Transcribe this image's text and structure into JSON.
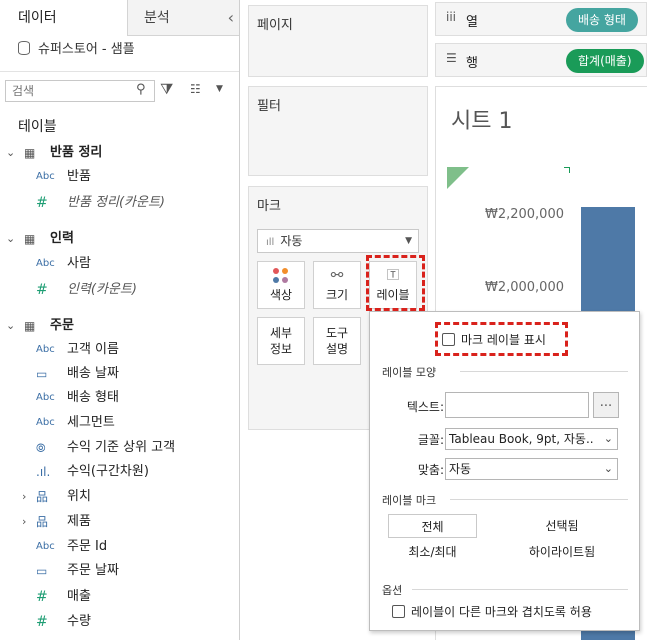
{
  "left_pane": {
    "tab_data": "데이터",
    "tab_analysis": "분석",
    "collapse": "‹",
    "datasource": "슈퍼스토어 - 샘플",
    "search_placeholder": "검색",
    "tables_heading": "테이블",
    "groups": [
      {
        "name": "반품 정리",
        "fields": [
          {
            "type": "Abc",
            "name": "반품",
            "italic": false
          },
          {
            "type": "#",
            "name": "반품 정리(카운트)",
            "italic": true
          }
        ]
      },
      {
        "name": "인력",
        "fields": [
          {
            "type": "Abc",
            "name": "사람",
            "italic": false
          },
          {
            "type": "#",
            "name": "인력(카운트)",
            "italic": true
          }
        ]
      },
      {
        "name": "주문",
        "fields": [
          {
            "type": "Abc",
            "name": "고객 이름"
          },
          {
            "type": "date",
            "name": "배송 날짜"
          },
          {
            "type": "Abc",
            "name": "배송 형태"
          },
          {
            "type": "Abc",
            "name": "세그먼트"
          },
          {
            "type": "set",
            "name": "수익 기준 상위 고객"
          },
          {
            "type": "bin",
            "name": "수익(구간차원)"
          },
          {
            "type": "hier",
            "name": "위치",
            "expandable": true
          },
          {
            "type": "hier",
            "name": "제품",
            "expandable": true
          },
          {
            "type": "Abc",
            "name": "주문 Id"
          },
          {
            "type": "date",
            "name": "주문 날짜"
          },
          {
            "type": "#",
            "name": "매출"
          },
          {
            "type": "#",
            "name": "수량"
          }
        ]
      }
    ]
  },
  "cards": {
    "pages": "페이지",
    "filters": "필터",
    "marks": "마크",
    "mark_type": "자동",
    "color": "색상",
    "size": "크기",
    "label": "레이블",
    "detail_1": "세부",
    "detail_2": "정보",
    "tooltip_1": "도구",
    "tooltip_2": "설명"
  },
  "shelves": {
    "columns_label": "열",
    "rows_label": "행",
    "columns_pill": "배송 형태",
    "rows_pill": "합계(매출)"
  },
  "view": {
    "sheet_title": "시트 1",
    "ticks": [
      "₩2,200,000",
      "₩2,000,000"
    ],
    "bar_color": "#4e79a7"
  },
  "label_popup": {
    "show_labels": "마크 레이블 표시",
    "appearance_heading": "레이블 모양",
    "text_label": "텍스트:",
    "text_value": "",
    "text_more": "...",
    "font_label": "글꼴:",
    "font_value": "Tableau Book, 9pt, 자동..",
    "align_label": "맞춤:",
    "align_value": "자동",
    "label_marks_heading": "레이블 마크",
    "opt_all": "전체",
    "opt_selected": "선택됨",
    "opt_minmax": "최소/최대",
    "opt_highlighted": "하이라이트됨",
    "options_heading": "옵션",
    "overlap": "레이블이 다른 마크와 겹치도록 허용"
  },
  "colors": {
    "highlight_red": "#d9221c",
    "pill_columns": "#45a5a0",
    "pill_rows": "#1a9b58"
  }
}
